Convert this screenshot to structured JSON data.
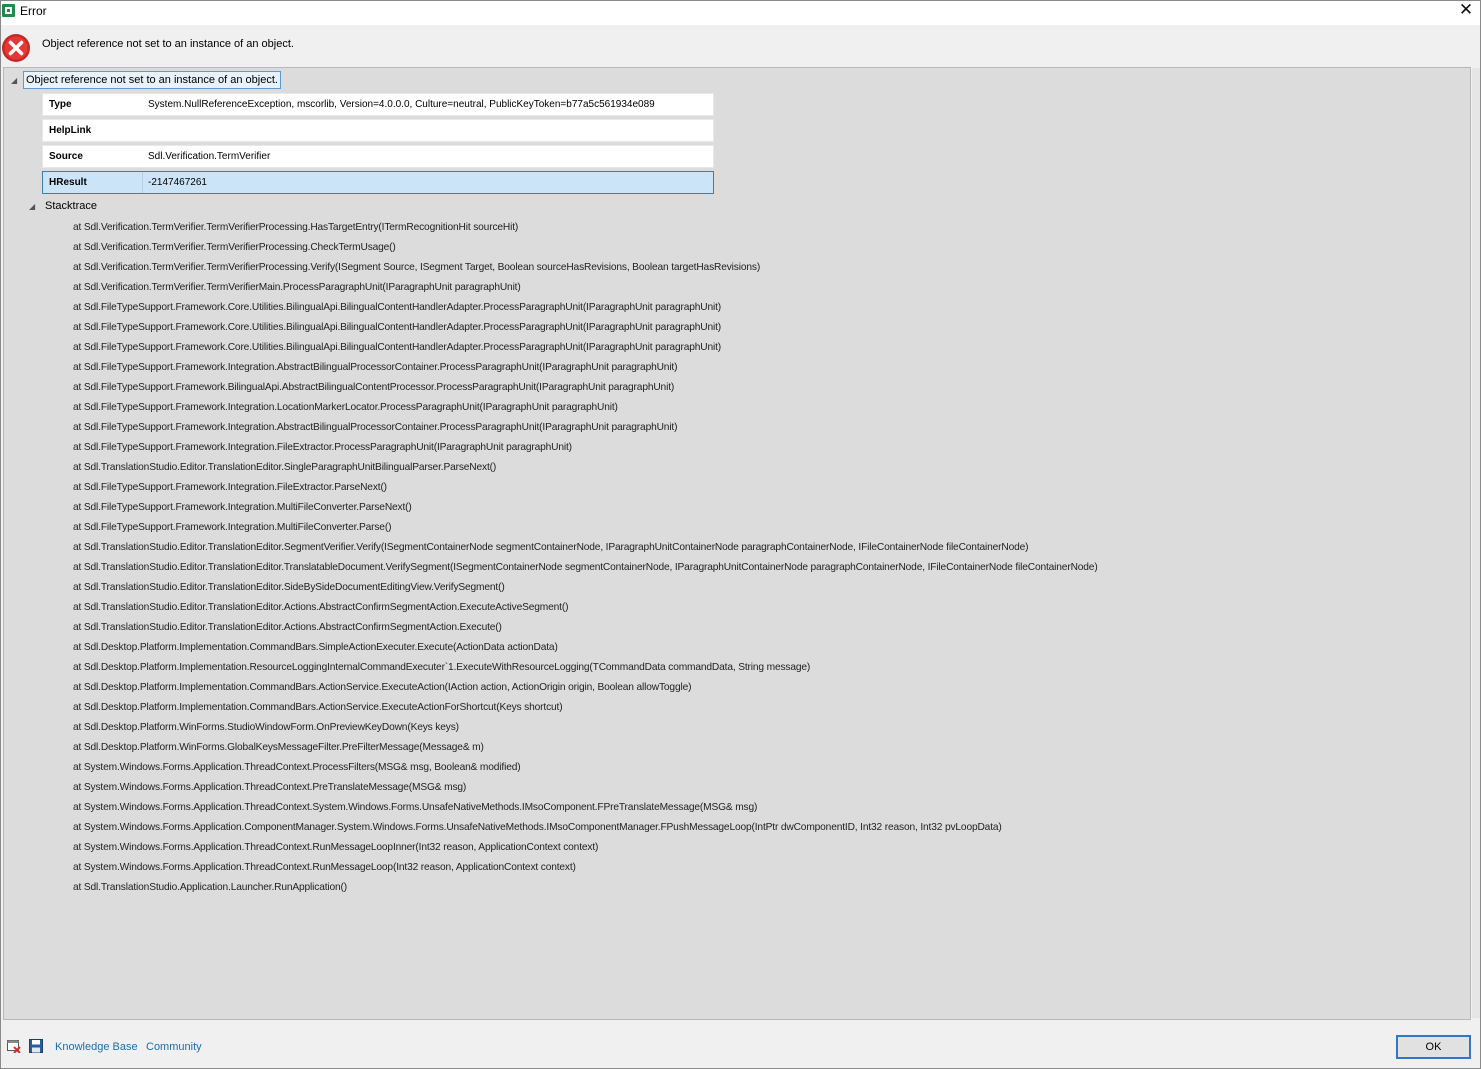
{
  "window": {
    "title": "Error"
  },
  "header": {
    "message": "Object reference not set to an instance of an object."
  },
  "tree": {
    "root_label": "Object reference not set to an instance of an object.",
    "properties": [
      {
        "key": "Type",
        "value": "System.NullReferenceException, mscorlib, Version=4.0.0.0, Culture=neutral, PublicKeyToken=b77a5c561934e089"
      },
      {
        "key": "HelpLink",
        "value": ""
      },
      {
        "key": "Source",
        "value": "Sdl.Verification.TermVerifier"
      },
      {
        "key": "HResult",
        "value": "-2147467261"
      }
    ],
    "stacktrace_label": "Stacktrace",
    "stacktrace": [
      "at Sdl.Verification.TermVerifier.TermVerifierProcessing.HasTargetEntry(ITermRecognitionHit sourceHit)",
      "at Sdl.Verification.TermVerifier.TermVerifierProcessing.CheckTermUsage()",
      "at Sdl.Verification.TermVerifier.TermVerifierProcessing.Verify(ISegment Source, ISegment Target, Boolean sourceHasRevisions, Boolean targetHasRevisions)",
      "at Sdl.Verification.TermVerifier.TermVerifierMain.ProcessParagraphUnit(IParagraphUnit paragraphUnit)",
      "at Sdl.FileTypeSupport.Framework.Core.Utilities.BilingualApi.BilingualContentHandlerAdapter.ProcessParagraphUnit(IParagraphUnit paragraphUnit)",
      "at Sdl.FileTypeSupport.Framework.Core.Utilities.BilingualApi.BilingualContentHandlerAdapter.ProcessParagraphUnit(IParagraphUnit paragraphUnit)",
      "at Sdl.FileTypeSupport.Framework.Core.Utilities.BilingualApi.BilingualContentHandlerAdapter.ProcessParagraphUnit(IParagraphUnit paragraphUnit)",
      "at Sdl.FileTypeSupport.Framework.Integration.AbstractBilingualProcessorContainer.ProcessParagraphUnit(IParagraphUnit paragraphUnit)",
      "at Sdl.FileTypeSupport.Framework.BilingualApi.AbstractBilingualContentProcessor.ProcessParagraphUnit(IParagraphUnit paragraphUnit)",
      "at Sdl.FileTypeSupport.Framework.Integration.LocationMarkerLocator.ProcessParagraphUnit(IParagraphUnit paragraphUnit)",
      "at Sdl.FileTypeSupport.Framework.Integration.AbstractBilingualProcessorContainer.ProcessParagraphUnit(IParagraphUnit paragraphUnit)",
      "at Sdl.FileTypeSupport.Framework.Integration.FileExtractor.ProcessParagraphUnit(IParagraphUnit paragraphUnit)",
      "at Sdl.TranslationStudio.Editor.TranslationEditor.SingleParagraphUnitBilingualParser.ParseNext()",
      "at Sdl.FileTypeSupport.Framework.Integration.FileExtractor.ParseNext()",
      "at Sdl.FileTypeSupport.Framework.Integration.MultiFileConverter.ParseNext()",
      "at Sdl.FileTypeSupport.Framework.Integration.MultiFileConverter.Parse()",
      "at Sdl.TranslationStudio.Editor.TranslationEditor.SegmentVerifier.Verify(ISegmentContainerNode segmentContainerNode, IParagraphUnitContainerNode paragraphContainerNode, IFileContainerNode fileContainerNode)",
      "at Sdl.TranslationStudio.Editor.TranslationEditor.TranslatableDocument.VerifySegment(ISegmentContainerNode segmentContainerNode, IParagraphUnitContainerNode paragraphContainerNode, IFileContainerNode fileContainerNode)",
      "at Sdl.TranslationStudio.Editor.TranslationEditor.SideBySideDocumentEditingView.VerifySegment()",
      "at Sdl.TranslationStudio.Editor.TranslationEditor.Actions.AbstractConfirmSegmentAction.ExecuteActiveSegment()",
      "at Sdl.TranslationStudio.Editor.TranslationEditor.Actions.AbstractConfirmSegmentAction.Execute()",
      "at Sdl.Desktop.Platform.Implementation.CommandBars.SimpleActionExecuter.Execute(ActionData actionData)",
      "at Sdl.Desktop.Platform.Implementation.ResourceLoggingInternalCommandExecuter`1.ExecuteWithResourceLogging(TCommandData commandData, String message)",
      "at Sdl.Desktop.Platform.Implementation.CommandBars.ActionService.ExecuteAction(IAction action, ActionOrigin origin, Boolean allowToggle)",
      "at Sdl.Desktop.Platform.Implementation.CommandBars.ActionService.ExecuteActionForShortcut(Keys shortcut)",
      "at Sdl.Desktop.Platform.WinForms.StudioWindowForm.OnPreviewKeyDown(Keys keys)",
      "at Sdl.Desktop.Platform.WinForms.GlobalKeysMessageFilter.PreFilterMessage(Message& m)",
      "at System.Windows.Forms.Application.ThreadContext.ProcessFilters(MSG& msg, Boolean& modified)",
      "at System.Windows.Forms.Application.ThreadContext.PreTranslateMessage(MSG& msg)",
      "at System.Windows.Forms.Application.ThreadContext.System.Windows.Forms.UnsafeNativeMethods.IMsoComponent.FPreTranslateMessage(MSG& msg)",
      "at System.Windows.Forms.Application.ComponentManager.System.Windows.Forms.UnsafeNativeMethods.IMsoComponentManager.FPushMessageLoop(IntPtr dwComponentID, Int32 reason, Int32 pvLoopData)",
      "at System.Windows.Forms.Application.ThreadContext.RunMessageLoopInner(Int32 reason, ApplicationContext context)",
      "at System.Windows.Forms.Application.ThreadContext.RunMessageLoop(Int32 reason, ApplicationContext context)",
      "at Sdl.TranslationStudio.Application.Launcher.RunApplication()"
    ]
  },
  "footer": {
    "knowledge_base": "Knowledge Base",
    "community": "Community",
    "ok": "OK"
  },
  "icons": {
    "app": "app-icon",
    "error": "error-icon",
    "close": "close-icon",
    "expand": "expanded-triangle-icon",
    "clear_log": "clear-log-icon",
    "save": "save-icon"
  },
  "colors": {
    "error_red": "#d32f2f",
    "link_blue": "#1a6fb0",
    "selection": "#cce4f7",
    "ok_border": "#3077c8"
  }
}
